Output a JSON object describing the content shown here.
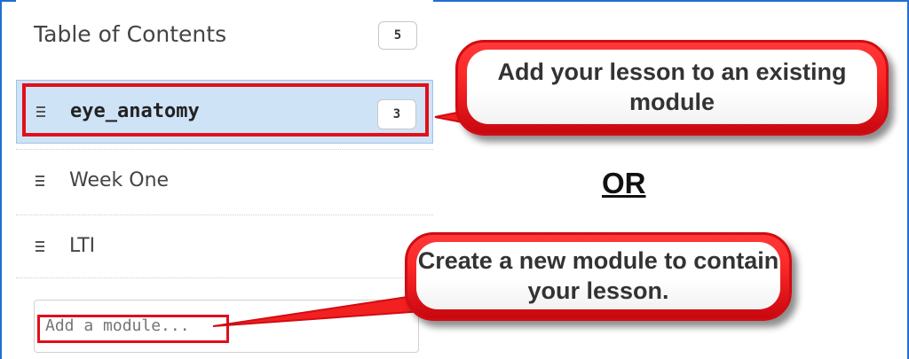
{
  "sidebar": {
    "title": "Table of Contents",
    "total_count": "5",
    "modules": [
      {
        "label": "eye_anatomy",
        "count": "3",
        "selected": true
      },
      {
        "label": "Week One"
      },
      {
        "label": "LTI"
      }
    ],
    "add_module_placeholder": "Add a module..."
  },
  "callouts": {
    "existing": "Add your lesson to an existing module",
    "or": "OR",
    "new": "Create a new module to contain your lesson."
  },
  "colors": {
    "frame": "#1f6fd1",
    "highlight": "#e0101a",
    "selected_bg": "#cfe3f7",
    "callout_red": "#fb2727"
  }
}
